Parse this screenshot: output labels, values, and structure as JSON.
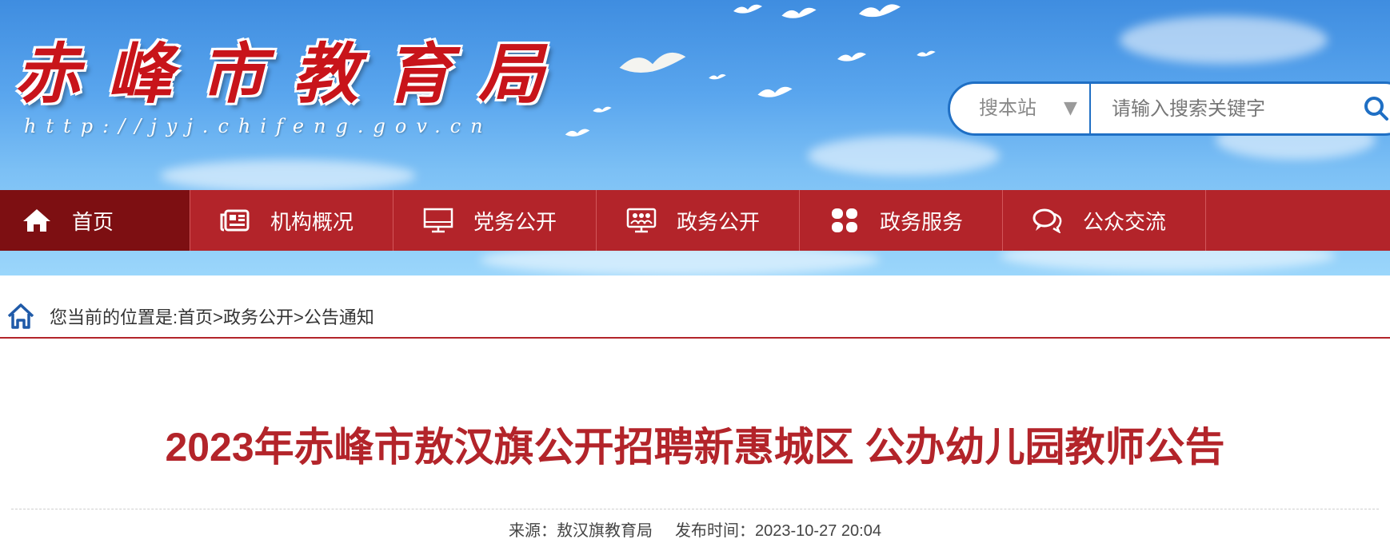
{
  "site": {
    "logo_title": "赤峰市教育局",
    "logo_url": "http://jyj.chifeng.gov.cn"
  },
  "search": {
    "scope": "搜本站",
    "placeholder": "请输入搜索关键字",
    "icon": "search-icon"
  },
  "nav": {
    "items": [
      {
        "label": "首页",
        "icon": "home-icon"
      },
      {
        "label": "机构概况",
        "icon": "newspaper-icon"
      },
      {
        "label": "党务公开",
        "icon": "monitor-icon"
      },
      {
        "label": "政务公开",
        "icon": "people-screen-icon"
      },
      {
        "label": "政务服务",
        "icon": "grid-icon"
      },
      {
        "label": "公众交流",
        "icon": "chat-icon"
      }
    ]
  },
  "breadcrumb": {
    "prefix": "您当前的位置是:",
    "items": [
      "首页",
      "政务公开",
      "公告通知"
    ],
    "separator": ">"
  },
  "article": {
    "title": "2023年赤峰市敖汉旗公开招聘新惠城区 公办幼儿园教师公告",
    "source_label": "来源：",
    "source": "敖汉旗教育局",
    "date_label": "发布时间：",
    "date": "2023-10-27 20:04"
  },
  "colors": {
    "brand_red": "#b3242a",
    "active_nav": "#7d0f12",
    "search_border": "#1f6fc4"
  }
}
